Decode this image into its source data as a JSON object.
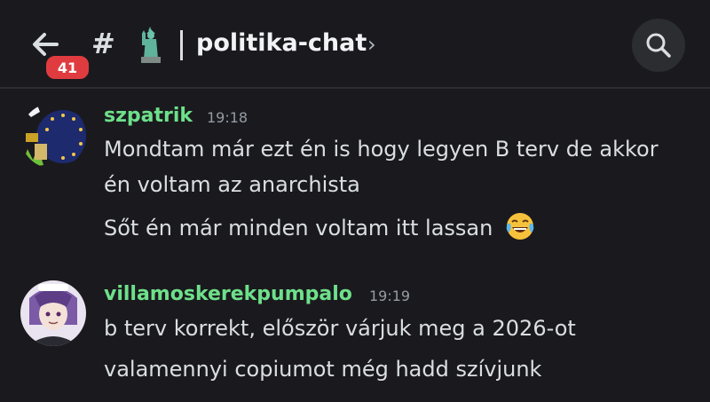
{
  "header": {
    "back_icon": "arrow-left-icon",
    "unread_badge": "41",
    "channel_prefix": "#",
    "channel_emoji": "statue-of-liberty",
    "channel_name": "politika-chat",
    "chevron": "›",
    "search_icon": "search-icon"
  },
  "messages": [
    {
      "author": "szpatrik",
      "time": "19:18",
      "author_color": "#6ee08a",
      "lines": [
        "Mondtam már ezt én is hogy legyen B terv de akkor",
        "én voltam az anarchista",
        "Sőt én már minden voltam itt lassan"
      ],
      "emoji": "face-with-tears-of-joy"
    },
    {
      "author": "villamoskerekpumpalo",
      "time": "19:19",
      "author_color": "#6ee08a",
      "lines": [
        "b terv korrekt, először várjuk meg a 2026-ot",
        "valamennyi copiumot még hadd szívjunk"
      ]
    }
  ]
}
